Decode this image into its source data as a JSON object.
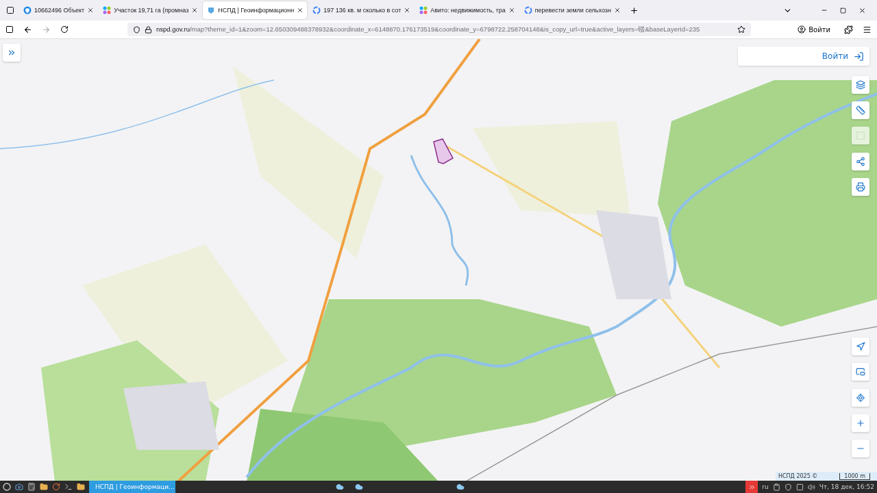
{
  "tabs": [
    {
      "title": "10662496 Объект",
      "selected": false
    },
    {
      "title": "Участок 19,71 га (промназ",
      "selected": false
    },
    {
      "title": "НСПД | Геоинформационн",
      "selected": true
    },
    {
      "title": "197 136 кв. м сколько в сот",
      "selected": false
    },
    {
      "title": "Авито: недвижимость, тра",
      "selected": false
    },
    {
      "title": "перевести земли сельхозн",
      "selected": false
    }
  ],
  "address_bar": {
    "host": "nspd.gov.ru",
    "path": "/map?theme_id=1&zoom=12.650309488378932&coordinate_x=6148870.176173519&coordinate_y=6798722.258704148&is_copy_url=true&active_layers=镪&baseLayerId=235"
  },
  "account_button": "Войти",
  "map": {
    "login_button": "Войти",
    "tools_top": [
      {
        "kind": "layers",
        "disabled": false
      },
      {
        "kind": "ruler",
        "disabled": false
      },
      {
        "kind": "select",
        "disabled": true
      },
      {
        "kind": "share",
        "disabled": false
      },
      {
        "kind": "print",
        "disabled": false
      }
    ],
    "tools_bottom": [
      {
        "kind": "navigate",
        "disabled": false
      },
      {
        "kind": "minimap",
        "disabled": false
      },
      {
        "kind": "locate",
        "disabled": false
      },
      {
        "kind": "plus",
        "disabled": false
      },
      {
        "kind": "minus",
        "disabled": false
      }
    ],
    "attribution": "НСПД 2025 ©",
    "scale": "1000 m"
  },
  "taskbar": {
    "active_window": "НСПД | Геоинформаци...",
    "language": "ru",
    "clock": "Чт, 18 дек, 16:52"
  }
}
